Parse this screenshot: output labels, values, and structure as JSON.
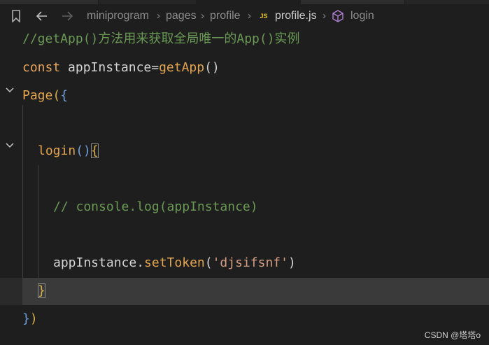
{
  "breadcrumb": {
    "folder1": "miniprogram",
    "folder2": "pages",
    "folder3": "profile",
    "file": "profile.js",
    "file_badge": "JS",
    "symbol": "login"
  },
  "code": {
    "line1_comment": "//getApp()方法用来获取全局唯一的App()实例",
    "line2_const": "const ",
    "line2_var": "appInstance=",
    "line2_fn": "getApp",
    "line2_parens": "()",
    "line3_fn": "Page",
    "line3_paren": "(",
    "line3_brace": "{",
    "line5_fn": "login",
    "line5_parens": "()",
    "line5_brace": "{",
    "line7_comment": "// console.log(appInstance)",
    "line9_obj": "appInstance.",
    "line9_method": "setToken",
    "line9_paren_open": "(",
    "line9_string": "'djsifsnf'",
    "line9_paren_close": ")",
    "line10_brace": "}",
    "line11_brace": "}",
    "line11_paren": ")"
  },
  "watermark": "CSDN @塔塔o",
  "colors": {
    "background": "#1e1e1e",
    "comment": "#6a9955",
    "keyword": "#e6a45e",
    "string": "#d69d85",
    "current_line": "#3a3a3a"
  }
}
